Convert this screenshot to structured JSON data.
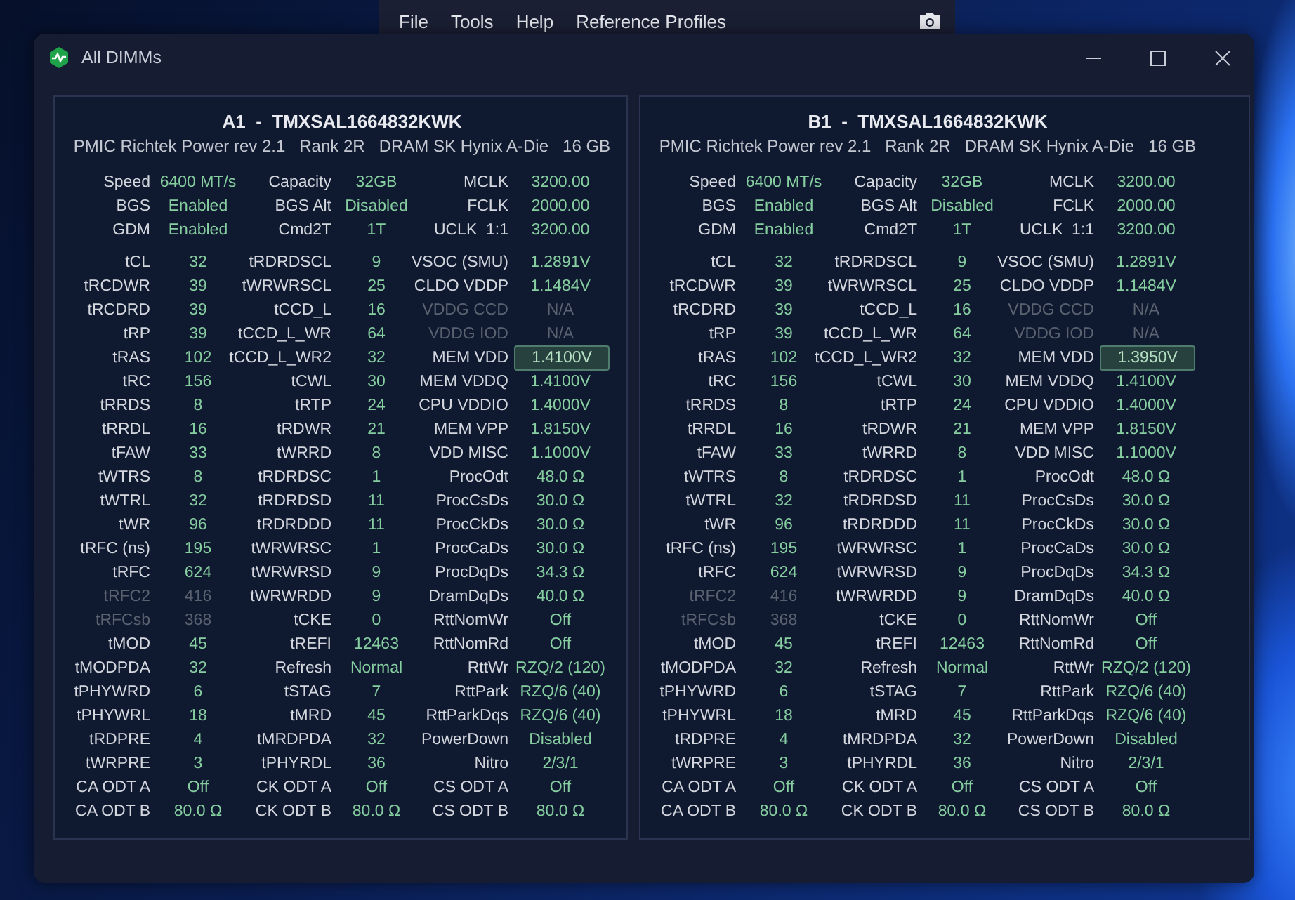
{
  "background_window": {
    "menu": [
      "File",
      "Tools",
      "Help",
      "Reference Profiles"
    ]
  },
  "window": {
    "title": "All DIMMs"
  },
  "dimms": [
    {
      "title": "A1  -  TMXSAL1664832KWK",
      "details": [
        "PMIC Richtek Power rev 2.1",
        "Rank 2R",
        "DRAM SK Hynix A-Die",
        "16 GB"
      ],
      "summary": [
        [
          {
            "label": "Speed",
            "value": "6400 MT/s",
            "dimmed": false,
            "selected": false
          },
          {
            "label": "Capacity",
            "value": "32GB",
            "dimmed": false,
            "selected": false
          },
          {
            "label": "MCLK",
            "value": "3200.00",
            "dimmed": false,
            "selected": false
          }
        ],
        [
          {
            "label": "BGS",
            "value": "Enabled",
            "dimmed": false,
            "selected": false
          },
          {
            "label": "BGS Alt",
            "value": "Disabled",
            "dimmed": false,
            "selected": false
          },
          {
            "label": "FCLK",
            "value": "2000.00",
            "dimmed": false,
            "selected": false
          }
        ],
        [
          {
            "label": "GDM",
            "value": "Enabled",
            "dimmed": false,
            "selected": false
          },
          {
            "label": "Cmd2T",
            "value": "1T",
            "dimmed": false,
            "selected": false
          },
          {
            "label": "UCLK  1:1",
            "value": "3200.00",
            "dimmed": false,
            "selected": false
          }
        ]
      ],
      "timings": [
        [
          {
            "label": "tCL",
            "value": "32",
            "dimmed": false,
            "selected": false
          },
          {
            "label": "tRDRDSCL",
            "value": "9",
            "dimmed": false,
            "selected": false
          },
          {
            "label": "VSOC (SMU)",
            "value": "1.2891V",
            "dimmed": false,
            "selected": false
          }
        ],
        [
          {
            "label": "tRCDWR",
            "value": "39",
            "dimmed": false,
            "selected": false
          },
          {
            "label": "tWRWRSCL",
            "value": "25",
            "dimmed": false,
            "selected": false
          },
          {
            "label": "CLDO VDDP",
            "value": "1.1484V",
            "dimmed": false,
            "selected": false
          }
        ],
        [
          {
            "label": "tRCDRD",
            "value": "39",
            "dimmed": false,
            "selected": false
          },
          {
            "label": "tCCD_L",
            "value": "16",
            "dimmed": false,
            "selected": false
          },
          {
            "label": "VDDG CCD",
            "value": "N/A",
            "dimmed": true,
            "selected": false
          }
        ],
        [
          {
            "label": "tRP",
            "value": "39",
            "dimmed": false,
            "selected": false
          },
          {
            "label": "tCCD_L_WR",
            "value": "64",
            "dimmed": false,
            "selected": false
          },
          {
            "label": "VDDG IOD",
            "value": "N/A",
            "dimmed": true,
            "selected": false
          }
        ],
        [
          {
            "label": "tRAS",
            "value": "102",
            "dimmed": false,
            "selected": false
          },
          {
            "label": "tCCD_L_WR2",
            "value": "32",
            "dimmed": false,
            "selected": false
          },
          {
            "label": "MEM VDD",
            "value": "1.4100V",
            "dimmed": false,
            "selected": true
          }
        ],
        [
          {
            "label": "tRC",
            "value": "156",
            "dimmed": false,
            "selected": false
          },
          {
            "label": "tCWL",
            "value": "30",
            "dimmed": false,
            "selected": false
          },
          {
            "label": "MEM VDDQ",
            "value": "1.4100V",
            "dimmed": false,
            "selected": false
          }
        ],
        [
          {
            "label": "tRRDS",
            "value": "8",
            "dimmed": false,
            "selected": false
          },
          {
            "label": "tRTP",
            "value": "24",
            "dimmed": false,
            "selected": false
          },
          {
            "label": "CPU VDDIO",
            "value": "1.4000V",
            "dimmed": false,
            "selected": false
          }
        ],
        [
          {
            "label": "tRRDL",
            "value": "16",
            "dimmed": false,
            "selected": false
          },
          {
            "label": "tRDWR",
            "value": "21",
            "dimmed": false,
            "selected": false
          },
          {
            "label": "MEM VPP",
            "value": "1.8150V",
            "dimmed": false,
            "selected": false
          }
        ],
        [
          {
            "label": "tFAW",
            "value": "33",
            "dimmed": false,
            "selected": false
          },
          {
            "label": "tWRRD",
            "value": "8",
            "dimmed": false,
            "selected": false
          },
          {
            "label": "VDD MISC",
            "value": "1.1000V",
            "dimmed": false,
            "selected": false
          }
        ],
        [
          {
            "label": "tWTRS",
            "value": "8",
            "dimmed": false,
            "selected": false
          },
          {
            "label": "tRDRDSC",
            "value": "1",
            "dimmed": false,
            "selected": false
          },
          {
            "label": "ProcOdt",
            "value": "48.0 Ω",
            "dimmed": false,
            "selected": false
          }
        ],
        [
          {
            "label": "tWTRL",
            "value": "32",
            "dimmed": false,
            "selected": false
          },
          {
            "label": "tRDRDSD",
            "value": "11",
            "dimmed": false,
            "selected": false
          },
          {
            "label": "ProcCsDs",
            "value": "30.0 Ω",
            "dimmed": false,
            "selected": false
          }
        ],
        [
          {
            "label": "tWR",
            "value": "96",
            "dimmed": false,
            "selected": false
          },
          {
            "label": "tRDRDDD",
            "value": "11",
            "dimmed": false,
            "selected": false
          },
          {
            "label": "ProcCkDs",
            "value": "30.0 Ω",
            "dimmed": false,
            "selected": false
          }
        ],
        [
          {
            "label": "tRFC (ns)",
            "value": "195",
            "dimmed": false,
            "selected": false
          },
          {
            "label": "tWRWRSC",
            "value": "1",
            "dimmed": false,
            "selected": false
          },
          {
            "label": "ProcCaDs",
            "value": "30.0 Ω",
            "dimmed": false,
            "selected": false
          }
        ],
        [
          {
            "label": "tRFC",
            "value": "624",
            "dimmed": false,
            "selected": false
          },
          {
            "label": "tWRWRSD",
            "value": "9",
            "dimmed": false,
            "selected": false
          },
          {
            "label": "ProcDqDs",
            "value": "34.3 Ω",
            "dimmed": false,
            "selected": false
          }
        ],
        [
          {
            "label": "tRFC2",
            "value": "416",
            "dimmed": true,
            "selected": false
          },
          {
            "label": "tWRWRDD",
            "value": "9",
            "dimmed": false,
            "selected": false
          },
          {
            "label": "DramDqDs",
            "value": "40.0 Ω",
            "dimmed": false,
            "selected": false
          }
        ],
        [
          {
            "label": "tRFCsb",
            "value": "368",
            "dimmed": true,
            "selected": false
          },
          {
            "label": "tCKE",
            "value": "0",
            "dimmed": false,
            "selected": false
          },
          {
            "label": "RttNomWr",
            "value": "Off",
            "dimmed": false,
            "selected": false
          }
        ],
        [
          {
            "label": "tMOD",
            "value": "45",
            "dimmed": false,
            "selected": false
          },
          {
            "label": "tREFI",
            "value": "12463",
            "dimmed": false,
            "selected": false
          },
          {
            "label": "RttNomRd",
            "value": "Off",
            "dimmed": false,
            "selected": false
          }
        ],
        [
          {
            "label": "tMODPDA",
            "value": "32",
            "dimmed": false,
            "selected": false
          },
          {
            "label": "Refresh",
            "value": "Normal",
            "dimmed": false,
            "selected": false
          },
          {
            "label": "RttWr",
            "value": "RZQ/2 (120)",
            "dimmed": false,
            "selected": false
          }
        ],
        [
          {
            "label": "tPHYWRD",
            "value": "6",
            "dimmed": false,
            "selected": false
          },
          {
            "label": "tSTAG",
            "value": "7",
            "dimmed": false,
            "selected": false
          },
          {
            "label": "RttPark",
            "value": "RZQ/6 (40)",
            "dimmed": false,
            "selected": false
          }
        ],
        [
          {
            "label": "tPHYWRL",
            "value": "18",
            "dimmed": false,
            "selected": false
          },
          {
            "label": "tMRD",
            "value": "45",
            "dimmed": false,
            "selected": false
          },
          {
            "label": "RttParkDqs",
            "value": "RZQ/6 (40)",
            "dimmed": false,
            "selected": false
          }
        ],
        [
          {
            "label": "tRDPRE",
            "value": "4",
            "dimmed": false,
            "selected": false
          },
          {
            "label": "tMRDPDA",
            "value": "32",
            "dimmed": false,
            "selected": false
          },
          {
            "label": "PowerDown",
            "value": "Disabled",
            "dimmed": false,
            "selected": false
          }
        ],
        [
          {
            "label": "tWRPRE",
            "value": "3",
            "dimmed": false,
            "selected": false
          },
          {
            "label": "tPHYRDL",
            "value": "36",
            "dimmed": false,
            "selected": false
          },
          {
            "label": "Nitro",
            "value": "2/3/1",
            "dimmed": false,
            "selected": false
          }
        ],
        [
          {
            "label": "CA ODT A",
            "value": "Off",
            "dimmed": false,
            "selected": false
          },
          {
            "label": "CK ODT A",
            "value": "Off",
            "dimmed": false,
            "selected": false
          },
          {
            "label": "CS ODT A",
            "value": "Off",
            "dimmed": false,
            "selected": false
          }
        ],
        [
          {
            "label": "CA ODT B",
            "value": "80.0 Ω",
            "dimmed": false,
            "selected": false
          },
          {
            "label": "CK ODT B",
            "value": "80.0 Ω",
            "dimmed": false,
            "selected": false
          },
          {
            "label": "CS ODT B",
            "value": "80.0 Ω",
            "dimmed": false,
            "selected": false
          }
        ]
      ]
    },
    {
      "title": "B1  -  TMXSAL1664832KWK",
      "details": [
        "PMIC Richtek Power rev 2.1",
        "Rank 2R",
        "DRAM SK Hynix A-Die",
        "16 GB"
      ],
      "summary": [
        [
          {
            "label": "Speed",
            "value": "6400 MT/s",
            "dimmed": false,
            "selected": false
          },
          {
            "label": "Capacity",
            "value": "32GB",
            "dimmed": false,
            "selected": false
          },
          {
            "label": "MCLK",
            "value": "3200.00",
            "dimmed": false,
            "selected": false
          }
        ],
        [
          {
            "label": "BGS",
            "value": "Enabled",
            "dimmed": false,
            "selected": false
          },
          {
            "label": "BGS Alt",
            "value": "Disabled",
            "dimmed": false,
            "selected": false
          },
          {
            "label": "FCLK",
            "value": "2000.00",
            "dimmed": false,
            "selected": false
          }
        ],
        [
          {
            "label": "GDM",
            "value": "Enabled",
            "dimmed": false,
            "selected": false
          },
          {
            "label": "Cmd2T",
            "value": "1T",
            "dimmed": false,
            "selected": false
          },
          {
            "label": "UCLK  1:1",
            "value": "3200.00",
            "dimmed": false,
            "selected": false
          }
        ]
      ],
      "timings": [
        [
          {
            "label": "tCL",
            "value": "32",
            "dimmed": false,
            "selected": false
          },
          {
            "label": "tRDRDSCL",
            "value": "9",
            "dimmed": false,
            "selected": false
          },
          {
            "label": "VSOC (SMU)",
            "value": "1.2891V",
            "dimmed": false,
            "selected": false
          }
        ],
        [
          {
            "label": "tRCDWR",
            "value": "39",
            "dimmed": false,
            "selected": false
          },
          {
            "label": "tWRWRSCL",
            "value": "25",
            "dimmed": false,
            "selected": false
          },
          {
            "label": "CLDO VDDP",
            "value": "1.1484V",
            "dimmed": false,
            "selected": false
          }
        ],
        [
          {
            "label": "tRCDRD",
            "value": "39",
            "dimmed": false,
            "selected": false
          },
          {
            "label": "tCCD_L",
            "value": "16",
            "dimmed": false,
            "selected": false
          },
          {
            "label": "VDDG CCD",
            "value": "N/A",
            "dimmed": true,
            "selected": false
          }
        ],
        [
          {
            "label": "tRP",
            "value": "39",
            "dimmed": false,
            "selected": false
          },
          {
            "label": "tCCD_L_WR",
            "value": "64",
            "dimmed": false,
            "selected": false
          },
          {
            "label": "VDDG IOD",
            "value": "N/A",
            "dimmed": true,
            "selected": false
          }
        ],
        [
          {
            "label": "tRAS",
            "value": "102",
            "dimmed": false,
            "selected": false
          },
          {
            "label": "tCCD_L_WR2",
            "value": "32",
            "dimmed": false,
            "selected": false
          },
          {
            "label": "MEM VDD",
            "value": "1.3950V",
            "dimmed": false,
            "selected": true
          }
        ],
        [
          {
            "label": "tRC",
            "value": "156",
            "dimmed": false,
            "selected": false
          },
          {
            "label": "tCWL",
            "value": "30",
            "dimmed": false,
            "selected": false
          },
          {
            "label": "MEM VDDQ",
            "value": "1.4100V",
            "dimmed": false,
            "selected": false
          }
        ],
        [
          {
            "label": "tRRDS",
            "value": "8",
            "dimmed": false,
            "selected": false
          },
          {
            "label": "tRTP",
            "value": "24",
            "dimmed": false,
            "selected": false
          },
          {
            "label": "CPU VDDIO",
            "value": "1.4000V",
            "dimmed": false,
            "selected": false
          }
        ],
        [
          {
            "label": "tRRDL",
            "value": "16",
            "dimmed": false,
            "selected": false
          },
          {
            "label": "tRDWR",
            "value": "21",
            "dimmed": false,
            "selected": false
          },
          {
            "label": "MEM VPP",
            "value": "1.8150V",
            "dimmed": false,
            "selected": false
          }
        ],
        [
          {
            "label": "tFAW",
            "value": "33",
            "dimmed": false,
            "selected": false
          },
          {
            "label": "tWRRD",
            "value": "8",
            "dimmed": false,
            "selected": false
          },
          {
            "label": "VDD MISC",
            "value": "1.1000V",
            "dimmed": false,
            "selected": false
          }
        ],
        [
          {
            "label": "tWTRS",
            "value": "8",
            "dimmed": false,
            "selected": false
          },
          {
            "label": "tRDRDSC",
            "value": "1",
            "dimmed": false,
            "selected": false
          },
          {
            "label": "ProcOdt",
            "value": "48.0 Ω",
            "dimmed": false,
            "selected": false
          }
        ],
        [
          {
            "label": "tWTRL",
            "value": "32",
            "dimmed": false,
            "selected": false
          },
          {
            "label": "tRDRDSD",
            "value": "11",
            "dimmed": false,
            "selected": false
          },
          {
            "label": "ProcCsDs",
            "value": "30.0 Ω",
            "dimmed": false,
            "selected": false
          }
        ],
        [
          {
            "label": "tWR",
            "value": "96",
            "dimmed": false,
            "selected": false
          },
          {
            "label": "tRDRDDD",
            "value": "11",
            "dimmed": false,
            "selected": false
          },
          {
            "label": "ProcCkDs",
            "value": "30.0 Ω",
            "dimmed": false,
            "selected": false
          }
        ],
        [
          {
            "label": "tRFC (ns)",
            "value": "195",
            "dimmed": false,
            "selected": false
          },
          {
            "label": "tWRWRSC",
            "value": "1",
            "dimmed": false,
            "selected": false
          },
          {
            "label": "ProcCaDs",
            "value": "30.0 Ω",
            "dimmed": false,
            "selected": false
          }
        ],
        [
          {
            "label": "tRFC",
            "value": "624",
            "dimmed": false,
            "selected": false
          },
          {
            "label": "tWRWRSD",
            "value": "9",
            "dimmed": false,
            "selected": false
          },
          {
            "label": "ProcDqDs",
            "value": "34.3 Ω",
            "dimmed": false,
            "selected": false
          }
        ],
        [
          {
            "label": "tRFC2",
            "value": "416",
            "dimmed": true,
            "selected": false
          },
          {
            "label": "tWRWRDD",
            "value": "9",
            "dimmed": false,
            "selected": false
          },
          {
            "label": "DramDqDs",
            "value": "40.0 Ω",
            "dimmed": false,
            "selected": false
          }
        ],
        [
          {
            "label": "tRFCsb",
            "value": "368",
            "dimmed": true,
            "selected": false
          },
          {
            "label": "tCKE",
            "value": "0",
            "dimmed": false,
            "selected": false
          },
          {
            "label": "RttNomWr",
            "value": "Off",
            "dimmed": false,
            "selected": false
          }
        ],
        [
          {
            "label": "tMOD",
            "value": "45",
            "dimmed": false,
            "selected": false
          },
          {
            "label": "tREFI",
            "value": "12463",
            "dimmed": false,
            "selected": false
          },
          {
            "label": "RttNomRd",
            "value": "Off",
            "dimmed": false,
            "selected": false
          }
        ],
        [
          {
            "label": "tMODPDA",
            "value": "32",
            "dimmed": false,
            "selected": false
          },
          {
            "label": "Refresh",
            "value": "Normal",
            "dimmed": false,
            "selected": false
          },
          {
            "label": "RttWr",
            "value": "RZQ/2 (120)",
            "dimmed": false,
            "selected": false
          }
        ],
        [
          {
            "label": "tPHYWRD",
            "value": "6",
            "dimmed": false,
            "selected": false
          },
          {
            "label": "tSTAG",
            "value": "7",
            "dimmed": false,
            "selected": false
          },
          {
            "label": "RttPark",
            "value": "RZQ/6 (40)",
            "dimmed": false,
            "selected": false
          }
        ],
        [
          {
            "label": "tPHYWRL",
            "value": "18",
            "dimmed": false,
            "selected": false
          },
          {
            "label": "tMRD",
            "value": "45",
            "dimmed": false,
            "selected": false
          },
          {
            "label": "RttParkDqs",
            "value": "RZQ/6 (40)",
            "dimmed": false,
            "selected": false
          }
        ],
        [
          {
            "label": "tRDPRE",
            "value": "4",
            "dimmed": false,
            "selected": false
          },
          {
            "label": "tMRDPDA",
            "value": "32",
            "dimmed": false,
            "selected": false
          },
          {
            "label": "PowerDown",
            "value": "Disabled",
            "dimmed": false,
            "selected": false
          }
        ],
        [
          {
            "label": "tWRPRE",
            "value": "3",
            "dimmed": false,
            "selected": false
          },
          {
            "label": "tPHYRDL",
            "value": "36",
            "dimmed": false,
            "selected": false
          },
          {
            "label": "Nitro",
            "value": "2/3/1",
            "dimmed": false,
            "selected": false
          }
        ],
        [
          {
            "label": "CA ODT A",
            "value": "Off",
            "dimmed": false,
            "selected": false
          },
          {
            "label": "CK ODT A",
            "value": "Off",
            "dimmed": false,
            "selected": false
          },
          {
            "label": "CS ODT A",
            "value": "Off",
            "dimmed": false,
            "selected": false
          }
        ],
        [
          {
            "label": "CA ODT B",
            "value": "80.0 Ω",
            "dimmed": false,
            "selected": false
          },
          {
            "label": "CK ODT B",
            "value": "80.0 Ω",
            "dimmed": false,
            "selected": false
          },
          {
            "label": "CS ODT B",
            "value": "80.0 Ω",
            "dimmed": false,
            "selected": false
          }
        ]
      ]
    }
  ]
}
